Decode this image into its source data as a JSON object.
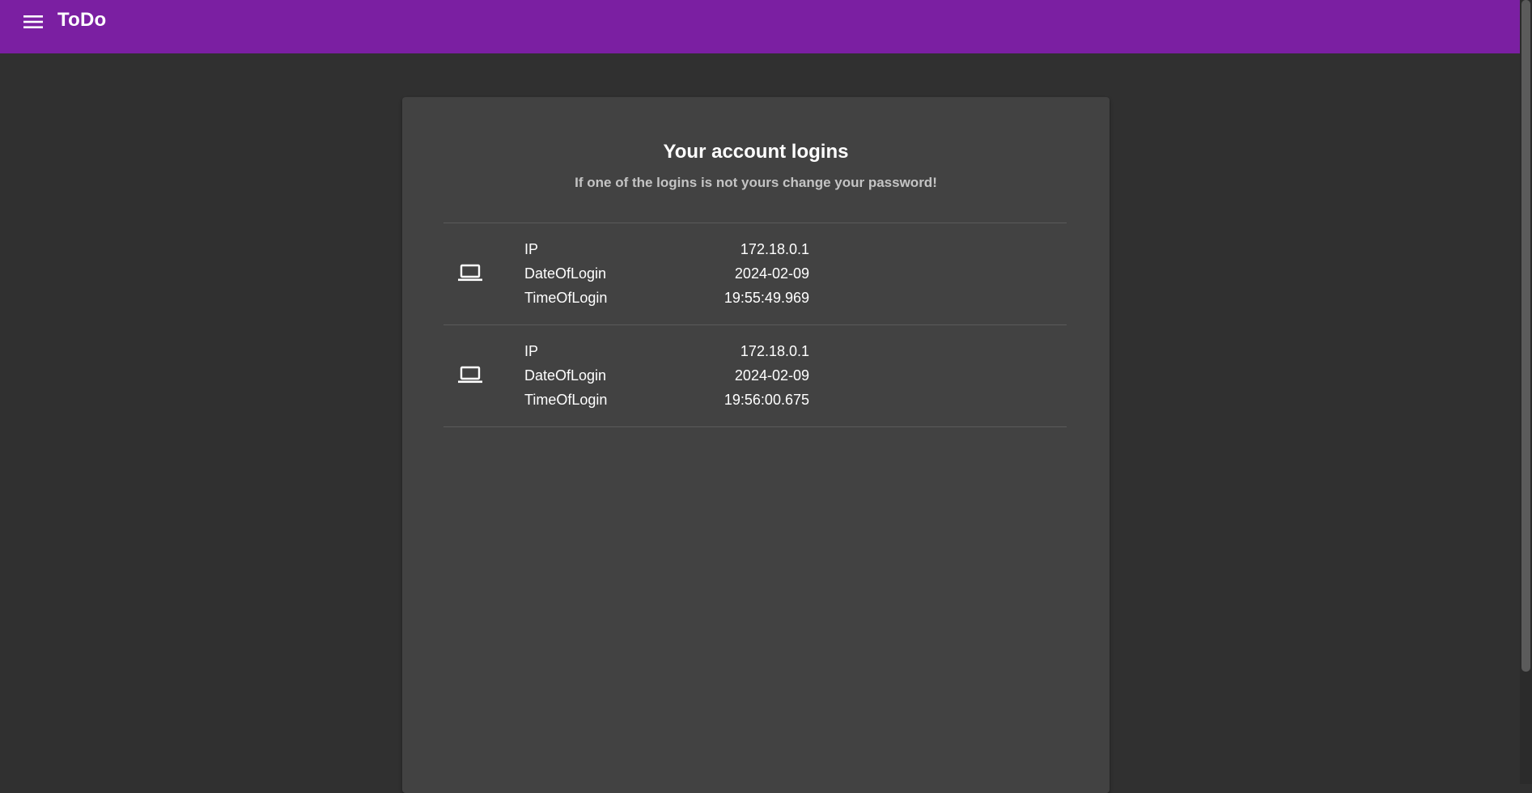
{
  "toolbar": {
    "menu_icon": "menu-icon",
    "title": "ToDo",
    "color": "#7b1fa2"
  },
  "card": {
    "title": "Your account logins",
    "subtitle": "If one of the logins is not yours change your password!"
  },
  "logins": [
    {
      "icon": "laptop-icon",
      "fields": [
        {
          "label": "IP",
          "value": "172.18.0.1"
        },
        {
          "label": "DateOfLogin",
          "value": "2024-02-09"
        },
        {
          "label": "TimeOfLogin",
          "value": "19:55:49.969"
        }
      ]
    },
    {
      "icon": "laptop-icon",
      "fields": [
        {
          "label": "IP",
          "value": "172.18.0.1"
        },
        {
          "label": "DateOfLogin",
          "value": "2024-02-09"
        },
        {
          "label": "TimeOfLogin",
          "value": "19:56:00.675"
        }
      ]
    }
  ]
}
